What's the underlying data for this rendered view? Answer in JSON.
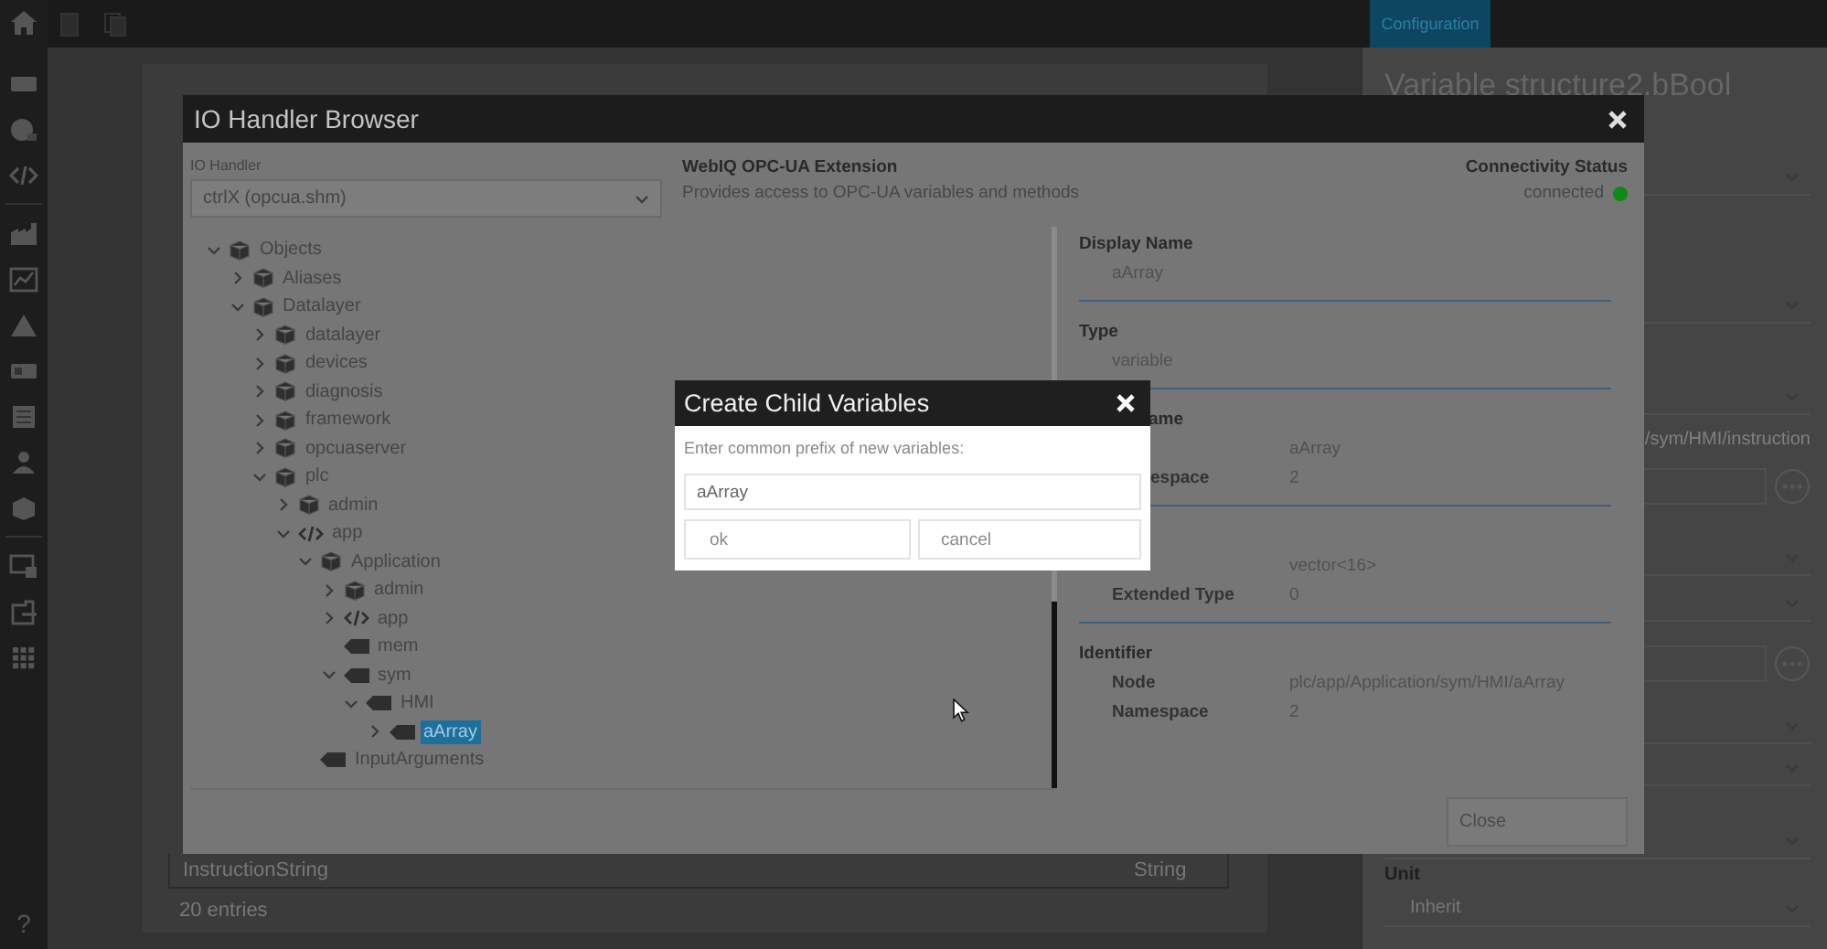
{
  "top_bar": {
    "tab": "Configuration"
  },
  "sidebar": {
    "help": "?"
  },
  "background": {
    "table_rows": [
      {
        "name": "InstructionString",
        "type": "String"
      }
    ],
    "entries": "20 entries",
    "panel_title": "Variable structure2.bBool",
    "path_value": "/sym/HMI/instruction",
    "unit_label": "Unit",
    "unit_value": "Inherit"
  },
  "io_browser": {
    "title": "IO Handler Browser",
    "handler_label": "IO Handler",
    "handler_value": "ctrlX (opcua.shm)",
    "extension_title": "WebIQ OPC-UA Extension",
    "extension_description": "Provides access to OPC-UA variables and methods",
    "status_label": "Connectivity Status",
    "status_value": "connected",
    "connected": true,
    "tree": [
      {
        "label": "Objects",
        "kind": "object",
        "expanded": true,
        "selected": false,
        "children": [
          {
            "label": "Aliases",
            "kind": "object",
            "expanded": false,
            "selected": false
          },
          {
            "label": "Datalayer",
            "kind": "object",
            "expanded": true,
            "selected": false,
            "children": [
              {
                "label": "datalayer",
                "kind": "object",
                "expanded": false,
                "selected": false
              },
              {
                "label": "devices",
                "kind": "object",
                "expanded": false,
                "selected": false
              },
              {
                "label": "diagnosis",
                "kind": "object",
                "expanded": false,
                "selected": false
              },
              {
                "label": "framework",
                "kind": "object",
                "expanded": false,
                "selected": false
              },
              {
                "label": "opcuaserver",
                "kind": "object",
                "expanded": false,
                "selected": false
              },
              {
                "label": "plc",
                "kind": "object",
                "expanded": true,
                "selected": false,
                "children": [
                  {
                    "label": "admin",
                    "kind": "object",
                    "expanded": false,
                    "selected": false
                  },
                  {
                    "label": "app",
                    "kind": "code",
                    "expanded": true,
                    "selected": false,
                    "children": [
                      {
                        "label": "Application",
                        "kind": "object",
                        "expanded": true,
                        "selected": false,
                        "children": [
                          {
                            "label": "admin",
                            "kind": "object",
                            "expanded": false,
                            "selected": false
                          },
                          {
                            "label": "app",
                            "kind": "code",
                            "expanded": false,
                            "selected": false
                          },
                          {
                            "label": "mem",
                            "kind": "variable",
                            "selected": false
                          },
                          {
                            "label": "sym",
                            "kind": "variable",
                            "expanded": true,
                            "selected": false,
                            "children": [
                              {
                                "label": "HMI",
                                "kind": "variable",
                                "expanded": true,
                                "selected": false,
                                "children": [
                                  {
                                    "label": "aArray",
                                    "kind": "variable",
                                    "expanded": false,
                                    "selected": true
                                  }
                                ]
                              }
                            ]
                          }
                        ]
                      },
                      {
                        "label": "InputArguments",
                        "kind": "variable",
                        "selected": false
                      }
                    ]
                  }
                ]
              }
            ]
          }
        ]
      }
    ],
    "details": [
      {
        "heading": "Display Name",
        "rows": [
          {
            "value": "aArray"
          }
        ]
      },
      {
        "heading": "Type",
        "rows": [
          {
            "value": "variable"
          }
        ]
      },
      {
        "heading": "ame",
        "rows": [
          {
            "value": "aArray"
          },
          {
            "label": "espace",
            "value": "2"
          }
        ]
      },
      {
        "rows": [
          {
            "value": "vector<16>"
          },
          {
            "label": "Extended Type",
            "value": "0"
          }
        ]
      },
      {
        "heading": "Identifier",
        "rows": [
          {
            "label": "Node",
            "value": "plc/app/Application/sym/HMI/aArray"
          },
          {
            "label": "Namespace",
            "value": "2"
          }
        ]
      }
    ],
    "close_button": "Close"
  },
  "child_dialog": {
    "title": "Create Child Variables",
    "prompt": "Enter common prefix of new variables:",
    "value": "aArray",
    "buttons": [
      "ok",
      "cancel"
    ]
  }
}
